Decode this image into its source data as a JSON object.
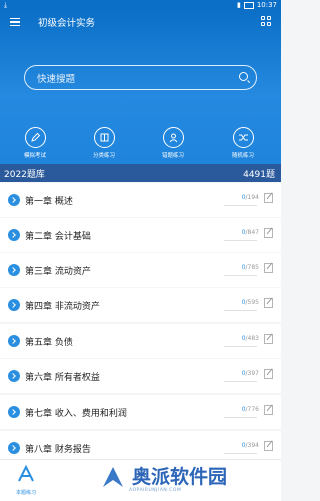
{
  "status_bar": {
    "time": "10:37",
    "download_icon": "download-icon"
  },
  "header": {
    "title": "初级会计实务",
    "menu_icon": "menu-icon",
    "grid_icon": "grid-icon"
  },
  "search": {
    "placeholder": "快速搜题"
  },
  "features": [
    {
      "label": "模拟考试",
      "icon": "pencil-icon"
    },
    {
      "label": "分类练习",
      "icon": "book-icon"
    },
    {
      "label": "错题练习",
      "icon": "user-icon"
    },
    {
      "label": "随机练习",
      "icon": "shuffle-icon"
    }
  ],
  "bank": {
    "label": "2022题库",
    "total": "4491题"
  },
  "chapters": [
    {
      "name": "第一章 概述",
      "done": "0",
      "total": "/194"
    },
    {
      "name": "第二章 会计基础",
      "done": "0",
      "total": "/847"
    },
    {
      "name": "第三章 流动资产",
      "done": "0",
      "total": "/785"
    },
    {
      "name": "第四章 非流动资产",
      "done": "0",
      "total": "/595"
    },
    {
      "name": "第五章 负债",
      "done": "0",
      "total": "/483"
    },
    {
      "name": "第六章 所有者权益",
      "done": "0",
      "total": "/397"
    },
    {
      "name": "第七章 收入、费用和利润",
      "done": "0",
      "total": "/776"
    },
    {
      "name": "第八章 财务报告",
      "done": "0",
      "total": "/394"
    }
  ],
  "footer": {
    "home_label": "本题练习",
    "watermark": "奥派软件园",
    "watermark_sub": "AOPAIRUNJIAN.COM"
  },
  "colors": {
    "primary": "#1f84dc",
    "bank_bar": "#2b5a9c",
    "accent": "#2a8fe0"
  }
}
